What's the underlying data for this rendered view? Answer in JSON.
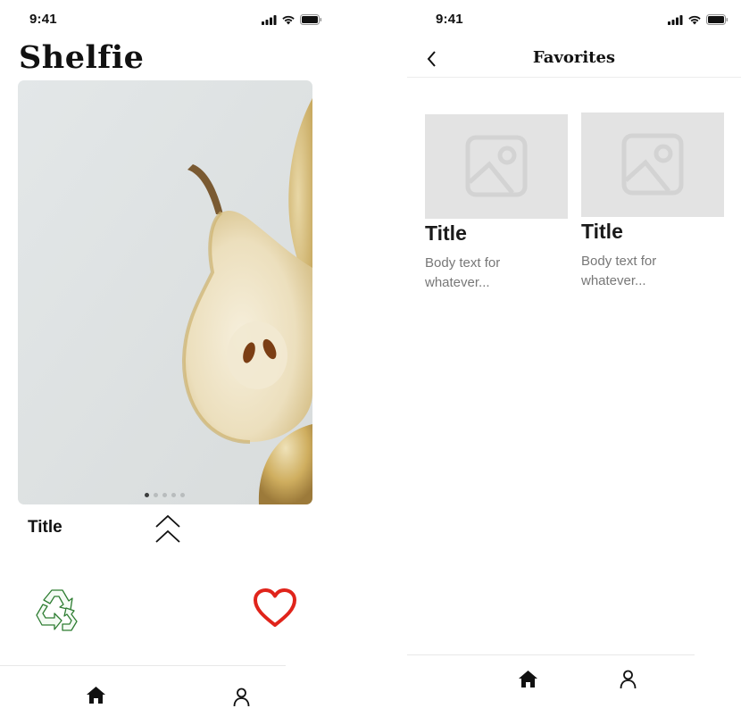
{
  "left_screen": {
    "status": {
      "time": "9:41"
    },
    "app_title": "Shelfie",
    "carousel": {
      "page_count": 5,
      "active_index": 0
    },
    "item_title": "Title",
    "icons": {
      "expand": "double-chevron-up-icon",
      "recycle": "recycle-icon",
      "favorite": "heart-icon"
    },
    "tabs": [
      {
        "name": "home",
        "icon": "home-icon"
      },
      {
        "name": "profile",
        "icon": "person-icon"
      }
    ]
  },
  "right_screen": {
    "status": {
      "time": "9:41"
    },
    "header": {
      "title": "Favorites",
      "back_icon": "chevron-left-icon"
    },
    "favorites": [
      {
        "title": "Title",
        "body": "Body text for whatever..."
      },
      {
        "title": "Title",
        "body": "Body text for whatever..."
      }
    ],
    "tabs": [
      {
        "name": "home",
        "icon": "home-icon"
      },
      {
        "name": "profile",
        "icon": "person-icon"
      }
    ]
  },
  "colors": {
    "heart": "#e0241b",
    "recycle": "#2e7d32",
    "placeholder": "#e3e3e3"
  }
}
